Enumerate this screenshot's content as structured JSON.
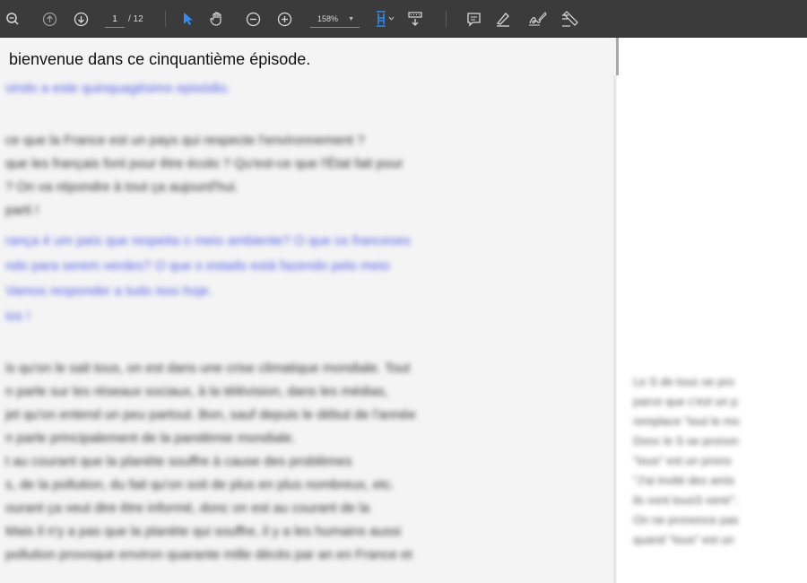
{
  "toolbar": {
    "page_current": "1",
    "page_total": "/ 12",
    "zoom": "158%",
    "icons": [
      "zoom-out-icon",
      "page-up-icon",
      "page-down-icon",
      "select-cursor-icon",
      "hand-tool-icon",
      "zoom-minus-icon",
      "zoom-plus-icon",
      "fit-page-icon",
      "scroll-mode-icon",
      "comment-icon",
      "highlight-pen-icon",
      "sign-icon",
      "fill-sign-icon"
    ]
  },
  "document": {
    "title_line": "bienvenue dans ce cinquantième épisode.",
    "left_lines": [
      {
        "text": "vindo a este quinquagésimo episódio.",
        "style": "blue"
      },
      {
        "text": "ce que la France est un pays qui respecte l'environnement ?",
        "style": "black"
      },
      {
        "text": "que les français font pour être écolo ? Qu'est-ce que l'État fait pour",
        "style": "black"
      },
      {
        "text": "? On va répondre à tout ça aujourd'hui.",
        "style": "black"
      },
      {
        "text": "parti !",
        "style": "black"
      },
      {
        "text": "rança é um país que respeita o meio ambiente? O que os franceses",
        "style": "blue"
      },
      {
        "text": "ndo para serem verdes? O que o estado está fazendo pelo meio",
        "style": "blue"
      },
      {
        "text": "Vamos responder a tudo isso hoje.",
        "style": "blue"
      },
      {
        "text": "ios !",
        "style": "blue"
      },
      {
        "text": "is qu'on le sait tous, on est dans une crise climatique mondiale. Tout",
        "style": "black"
      },
      {
        "text": "n parle sur les réseaux sociaux, à la télévision, dans les médias,",
        "style": "black"
      },
      {
        "text": "jet qu'on entend un peu partout. Bon, sauf depuis le début de l'année",
        "style": "black"
      },
      {
        "text": "n parle principalement de la pandémie mondiale.",
        "style": "black"
      },
      {
        "text": "t au courant que la planète souffre à cause des problèmes",
        "style": "black"
      },
      {
        "text": "s, de la pollution, du fait qu'on soit de plus en plus nombreux, etc.",
        "style": "black"
      },
      {
        "text": "ourant ça veut dire être informé, donc on est au courant de la",
        "style": "black"
      },
      {
        "text": "Mais il n'y a pas que la planète qui souffre, il y a les humains aussi",
        "style": "black"
      },
      {
        "text": "pollution provoque environ quarante mille décès par an en France et",
        "style": "black"
      }
    ],
    "right_lines": [
      "Le S de tous se pro",
      "parce que c'est un p",
      "remplace \"tout le mo",
      "Donc le S se pronon",
      "\"tous\" est un prono",
      "\"J'ai invité des amis",
      "ils vont tousS venir\".",
      "On ne prononce pas",
      "quand \"tous\" est un"
    ]
  }
}
